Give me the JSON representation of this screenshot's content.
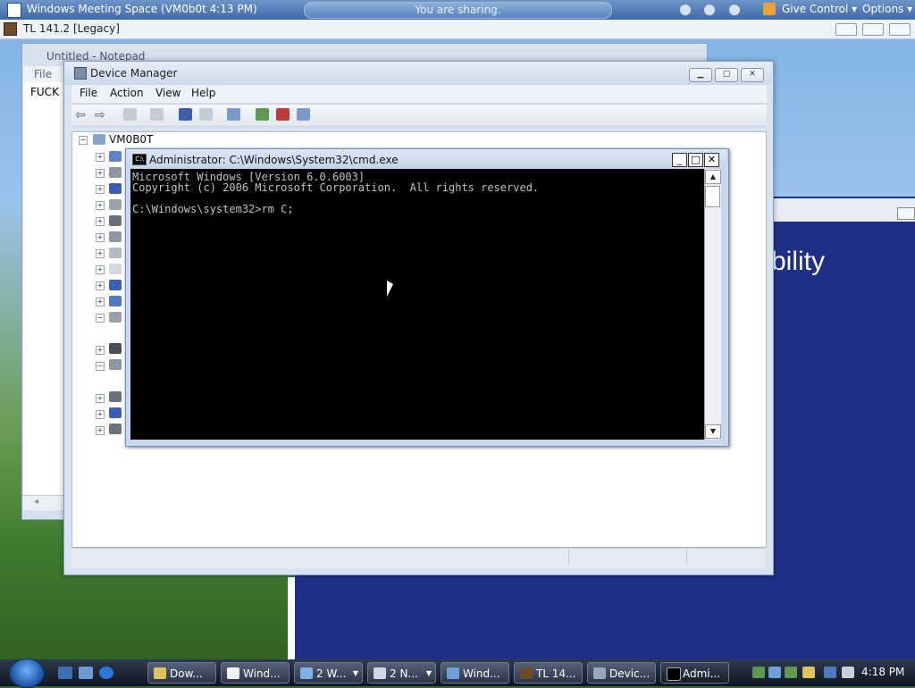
{
  "meeting_bar": {
    "title": "Windows Meeting Space (VM0b0t 4:13 PM)",
    "sharing_status": "You are sharing.",
    "give_control": "Give Control ▾",
    "options": "Options ▾"
  },
  "tl_window": {
    "title": "TL 141.2 [Legacy]"
  },
  "notepad": {
    "title": "Untitled - Notepad",
    "menu_file": "File",
    "content": "FUCK"
  },
  "background_window": {
    "partial_text": "bility"
  },
  "device_manager": {
    "title": "Device Manager",
    "menu": [
      "File",
      "Action",
      "View",
      "Help"
    ],
    "tree_root": "VM0B0T"
  },
  "cmd": {
    "title": "Administrator: C:\\Windows\\System32\\cmd.exe",
    "lines": [
      "Microsoft Windows [Version 6.0.6003]",
      "Copyright (c) 2006 Microsoft Corporation.  All rights reserved.",
      "",
      "C:\\Windows\\system32>rm C;"
    ]
  },
  "taskbar": {
    "buttons": [
      {
        "label": "Dow...",
        "icon": "folder-icon",
        "color": "#e0c25a"
      },
      {
        "label": "Wind...",
        "icon": "meeting-space-icon",
        "color": "#f2f2f2"
      },
      {
        "label": "2 W...",
        "icon": "meeting-space-icon",
        "color": "#7fb0e0",
        "group": true
      },
      {
        "label": "2 N...",
        "icon": "notepad-icon",
        "color": "#cfd9e6",
        "group": true
      },
      {
        "label": "Wind...",
        "icon": "windows-icon",
        "color": "#6ea0d8"
      },
      {
        "label": "TL 14...",
        "icon": "minecraft-icon",
        "color": "#6e4b2b"
      },
      {
        "label": "Devic...",
        "icon": "device-manager-icon",
        "color": "#9aa7bb"
      },
      {
        "label": "Admi...",
        "icon": "cmd-icon",
        "color": "#000000",
        "active": true
      }
    ],
    "clock": "4:18 PM"
  }
}
